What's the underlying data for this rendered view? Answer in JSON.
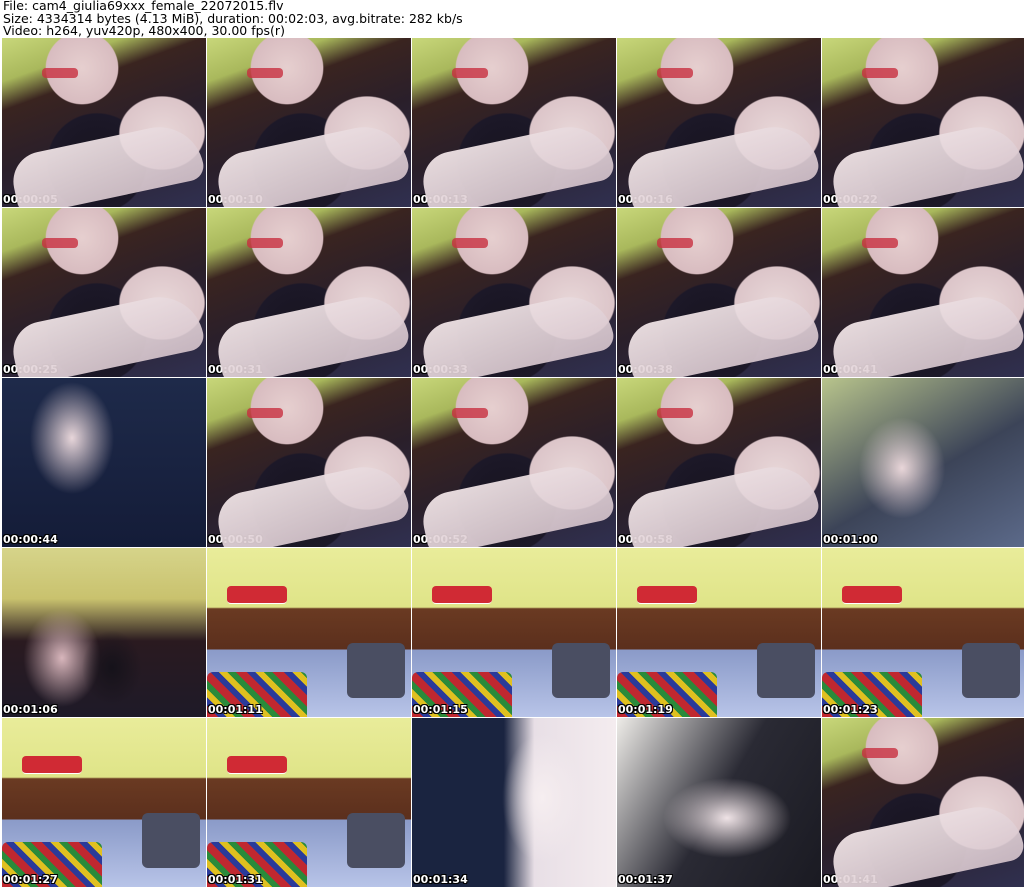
{
  "header": {
    "file_line": "File: cam4_giulia69xxx_female_22072015.flv",
    "size_line": "Size: 4334314 bytes (4.13 MiB), duration: 00:02:03, avg.bitrate: 282 kb/s",
    "video_line": "Video: h264, yuv420p, 480x400, 30.00 fps(r)"
  },
  "thumbnails": [
    {
      "timestamp": "00:00:05",
      "scene": "person"
    },
    {
      "timestamp": "00:00:10",
      "scene": "person"
    },
    {
      "timestamp": "00:00:13",
      "scene": "person"
    },
    {
      "timestamp": "00:00:16",
      "scene": "person"
    },
    {
      "timestamp": "00:00:22",
      "scene": "person"
    },
    {
      "timestamp": "00:00:25",
      "scene": "person"
    },
    {
      "timestamp": "00:00:31",
      "scene": "person"
    },
    {
      "timestamp": "00:00:33",
      "scene": "person"
    },
    {
      "timestamp": "00:00:38",
      "scene": "person"
    },
    {
      "timestamp": "00:00:41",
      "scene": "person"
    },
    {
      "timestamp": "00:00:44",
      "scene": "blur-dark"
    },
    {
      "timestamp": "00:00:50",
      "scene": "person"
    },
    {
      "timestamp": "00:00:52",
      "scene": "person"
    },
    {
      "timestamp": "00:00:58",
      "scene": "person"
    },
    {
      "timestamp": "00:01:00",
      "scene": "blur-light"
    },
    {
      "timestamp": "00:01:06",
      "scene": "person-green"
    },
    {
      "timestamp": "00:01:11",
      "scene": "bed"
    },
    {
      "timestamp": "00:01:15",
      "scene": "bed"
    },
    {
      "timestamp": "00:01:19",
      "scene": "bed"
    },
    {
      "timestamp": "00:01:23",
      "scene": "bed"
    },
    {
      "timestamp": "00:01:27",
      "scene": "bed"
    },
    {
      "timestamp": "00:01:31",
      "scene": "bed"
    },
    {
      "timestamp": "00:01:34",
      "scene": "blur-hand"
    },
    {
      "timestamp": "00:01:37",
      "scene": "blur-arm"
    },
    {
      "timestamp": "00:01:41",
      "scene": "person"
    }
  ]
}
